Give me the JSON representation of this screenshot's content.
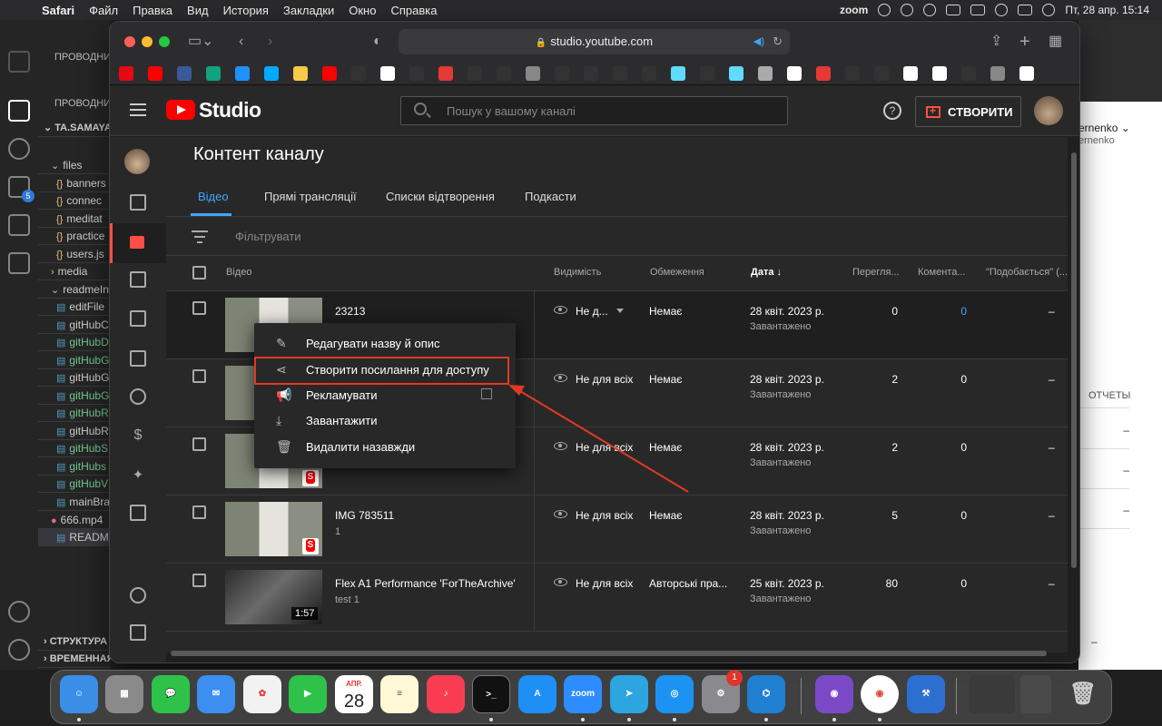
{
  "menubar": {
    "app": "Safari",
    "items": [
      "Файл",
      "Правка",
      "Вид",
      "История",
      "Закладки",
      "Окно",
      "Справка"
    ],
    "zoom": "zoom",
    "datetime": "Пт, 28 апр.  15:14"
  },
  "vscode": {
    "explorer_header": "ПРОВОДНИК",
    "explorer_header2": "ПРОВОДНИ",
    "project": "TA.SAMAYA",
    "badge": "5",
    "tree": [
      {
        "icon": "folder",
        "label": "files"
      },
      {
        "icon": "{}",
        "label": "banners"
      },
      {
        "icon": "{}",
        "label": "connec"
      },
      {
        "icon": "{}",
        "label": "meditat"
      },
      {
        "icon": "{}",
        "label": "practice"
      },
      {
        "icon": "{}",
        "label": "users.js"
      },
      {
        "icon": "folder",
        "label": "media"
      },
      {
        "icon": "folder",
        "label": "readmeIn"
      },
      {
        "icon": "md",
        "label": "editFile"
      },
      {
        "icon": "md",
        "label": "gitHubC"
      },
      {
        "icon": "md",
        "label": "gitHubD"
      },
      {
        "icon": "md",
        "label": "gitHubG"
      },
      {
        "icon": "md",
        "label": "gitHubG"
      },
      {
        "icon": "md",
        "label": "gitHubG"
      },
      {
        "icon": "md",
        "label": "gitHubR"
      },
      {
        "icon": "md",
        "label": "gitHubR"
      },
      {
        "icon": "md",
        "label": "gitHubS"
      },
      {
        "icon": "md",
        "label": "gitHubs"
      },
      {
        "icon": "md",
        "label": "gitHubV"
      },
      {
        "icon": "md",
        "label": "mainBra"
      },
      {
        "icon": "video",
        "label": "666.mp4"
      },
      {
        "icon": "md",
        "label": "READMI"
      }
    ],
    "outline": "СТРУКТУРА",
    "timeline": "ВРЕМЕННАЯ ШКАЛА",
    "right_user": "ernenko",
    "right_user2": "ernenko",
    "right_reports": "ОТЧЕТЫ",
    "right_dashes": [
      "–",
      "–",
      "–",
      "–"
    ]
  },
  "safari": {
    "url": "studio.youtube.com"
  },
  "studio": {
    "logo_text": "Studio",
    "search_placeholder": "Пошук у вашому каналі",
    "help": "?",
    "create_label": "СТВОРИТИ",
    "page_title": "Контент каналу",
    "tabs": [
      "Відео",
      "Прямі трансляції",
      "Списки відтворення",
      "Подкасти"
    ],
    "filter_label": "Фільтрувати",
    "columns": {
      "video": "Відео",
      "visibility": "Видимість",
      "restrictions": "Обмеження",
      "date": "Дата",
      "views": "Перегля...",
      "comments": "Комента...",
      "likes": "\"Подобається\" (..."
    },
    "rows": [
      {
        "title": "23213",
        "description": "",
        "visibility": "Не д...",
        "restrictions": "Немає",
        "date": "28 квіт. 2023 р.",
        "status": "Завантажено",
        "views": "0",
        "comments": "0",
        "likes": "–"
      },
      {
        "title": "",
        "description": "",
        "visibility": "Не для всіх",
        "restrictions": "Немає",
        "date": "28 квіт. 2023 р.",
        "status": "Завантажено",
        "views": "2",
        "comments": "0",
        "likes": "–"
      },
      {
        "title": "",
        "description": "",
        "visibility": "Не для всіх",
        "restrictions": "Немає",
        "date": "28 квіт. 2023 р.",
        "status": "Завантажено",
        "views": "2",
        "comments": "0",
        "likes": "–"
      },
      {
        "title": "IMG 783511",
        "description": "1",
        "visibility": "Не для всіх",
        "restrictions": "Немає",
        "date": "28 квіт. 2023 р.",
        "status": "Завантажено",
        "views": "5",
        "comments": "0",
        "likes": "–"
      },
      {
        "title": "Flex A1 Performance 'ForTheArchive'",
        "description": "test 1",
        "visibility": "Не для всіх",
        "restrictions": "Авторські пра...",
        "date": "25 квіт. 2023 р.",
        "status": "Завантажено",
        "views": "80",
        "comments": "0",
        "likes": "–",
        "duration": "1:57"
      }
    ],
    "context_menu": [
      "Редагувати назву й опис",
      "Створити посилання для доступу",
      "Рекламувати",
      "Завантажити",
      "Видалити назавжди"
    ]
  },
  "dock": {
    "calendar_month": "АПР.",
    "calendar_day": "28",
    "zoom_label": "zoom",
    "settings_badge": "1"
  },
  "colors": {
    "accent_red": "#ff4e45",
    "link_blue": "#3ea6ff",
    "annotation_red": "#e03a24"
  }
}
